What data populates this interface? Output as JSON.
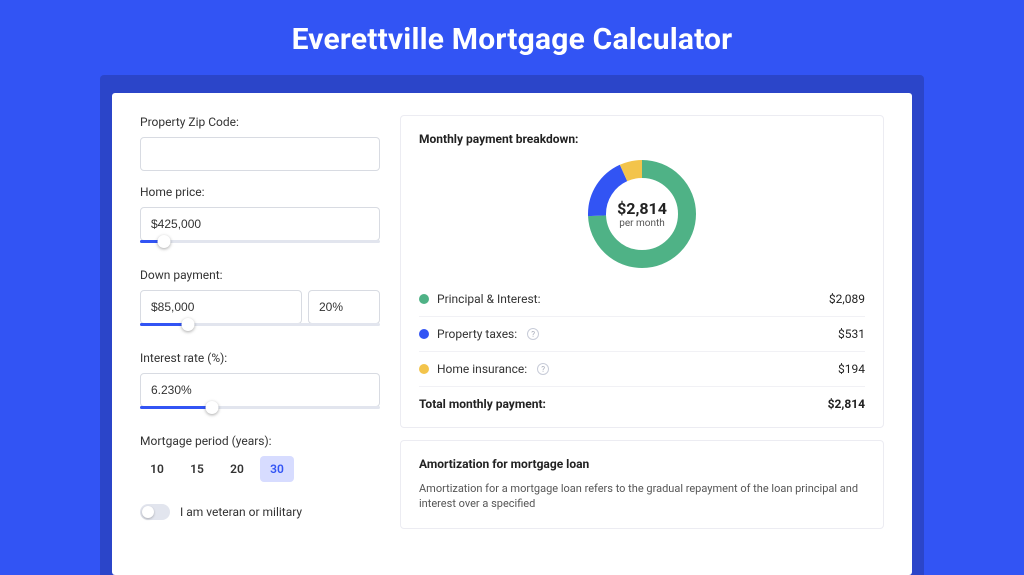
{
  "title": "Everettville Mortgage Calculator",
  "form": {
    "zip": {
      "label": "Property Zip Code:",
      "value": ""
    },
    "home_price": {
      "label": "Home price:",
      "value": "$425,000",
      "slider_pct": 10
    },
    "down_payment": {
      "label": "Down payment:",
      "value": "$85,000",
      "pct_value": "20%",
      "slider_pct": 20
    },
    "interest_rate": {
      "label": "Interest rate (%):",
      "value": "6.230%",
      "slider_pct": 30
    },
    "period": {
      "label": "Mortgage period (years):",
      "options": [
        "10",
        "15",
        "20",
        "30"
      ],
      "selected": "30"
    },
    "veteran": {
      "label": "I am veteran or military",
      "checked": false
    }
  },
  "breakdown": {
    "title": "Monthly payment breakdown:",
    "total_amount": "$2,814",
    "per_month_label": "per month",
    "items": [
      {
        "dot": "green",
        "label": "Principal & Interest:",
        "value": "$2,089",
        "help": false
      },
      {
        "dot": "blue",
        "label": "Property taxes:",
        "value": "$531",
        "help": true
      },
      {
        "dot": "yellow",
        "label": "Home insurance:",
        "value": "$194",
        "help": true
      }
    ],
    "total_label": "Total monthly payment:",
    "total_value": "$2,814"
  },
  "amortization": {
    "title": "Amortization for mortgage loan",
    "body": "Amortization for a mortgage loan refers to the gradual repayment of the loan principal and interest over a specified"
  },
  "chart_data": {
    "type": "pie",
    "title": "Monthly payment breakdown",
    "series": [
      {
        "name": "Principal & Interest",
        "value": 2089,
        "color": "#4fb286"
      },
      {
        "name": "Property taxes",
        "value": 531,
        "color": "#3254f4"
      },
      {
        "name": "Home insurance",
        "value": 194,
        "color": "#f3c44b"
      }
    ],
    "total": 2814,
    "center_label": "$2,814",
    "center_sub": "per month"
  }
}
